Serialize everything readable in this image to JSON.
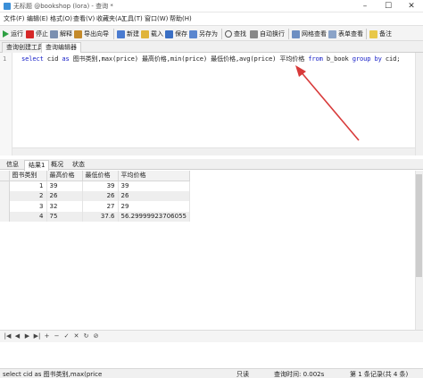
{
  "window": {
    "title": "无标题 @bookshop (lora) - 查询 *",
    "controls": [
      "–",
      "☐",
      "✕"
    ]
  },
  "menu": [
    "文件(F)",
    "编辑(E)",
    "格式(O)",
    "查看(V)",
    "收藏夹(A)",
    "工具(T)",
    "窗口(W)",
    "帮助(H)"
  ],
  "toolbar": {
    "run": "运行",
    "stop": "停止",
    "explain": "解释",
    "import_wizard": "导出向导",
    "new": "新建",
    "load": "载入",
    "save": "保存",
    "save_as": "另存为",
    "find": "查找",
    "word_wrap": "自动换行",
    "grid_view": "网格查看",
    "form_view": "表单查看",
    "note": "备注"
  },
  "tabs": [
    "查询创建工具",
    "查询编辑器"
  ],
  "editor": {
    "line_number": "1",
    "sql_parts": {
      "select": "select",
      "cid": " cid ",
      "as": "as",
      "rest": " 图书类别,max(price) 最高价格,min(price) 最低价格,avg(price) 平均价格 ",
      "from": "from",
      "table": " b_book ",
      "group": "group",
      "by": "by",
      "tail": " cid;"
    }
  },
  "result_tabs": [
    "信息",
    "结果1",
    "概况",
    "状态"
  ],
  "grid": {
    "columns": [
      "图书类别",
      "最高价格",
      "最低价格",
      "平均价格"
    ],
    "rows": [
      {
        "cid": "1",
        "max": "39",
        "min": "39",
        "avg": "39"
      },
      {
        "cid": "2",
        "max": "26",
        "min": "26",
        "avg": "26"
      },
      {
        "cid": "3",
        "max": "32",
        "min": "27",
        "avg": "29"
      },
      {
        "cid": "4",
        "max": "75",
        "min": "37.6",
        "avg": "56.29999923706055"
      }
    ]
  },
  "navbar": [
    "|◀",
    "◀",
    "▶",
    "▶|",
    "+",
    "−",
    "✓",
    "✕",
    "↻",
    "⊘"
  ],
  "status": {
    "query_text": "select cid as 图书类别,max(price",
    "readonly": "只读",
    "query_time": "查询时间: 0.002s",
    "record": "第 1 条记录(共 4 条)"
  },
  "colors": {
    "keyword": "#1a22c8",
    "arrow": "#d83a3a"
  }
}
